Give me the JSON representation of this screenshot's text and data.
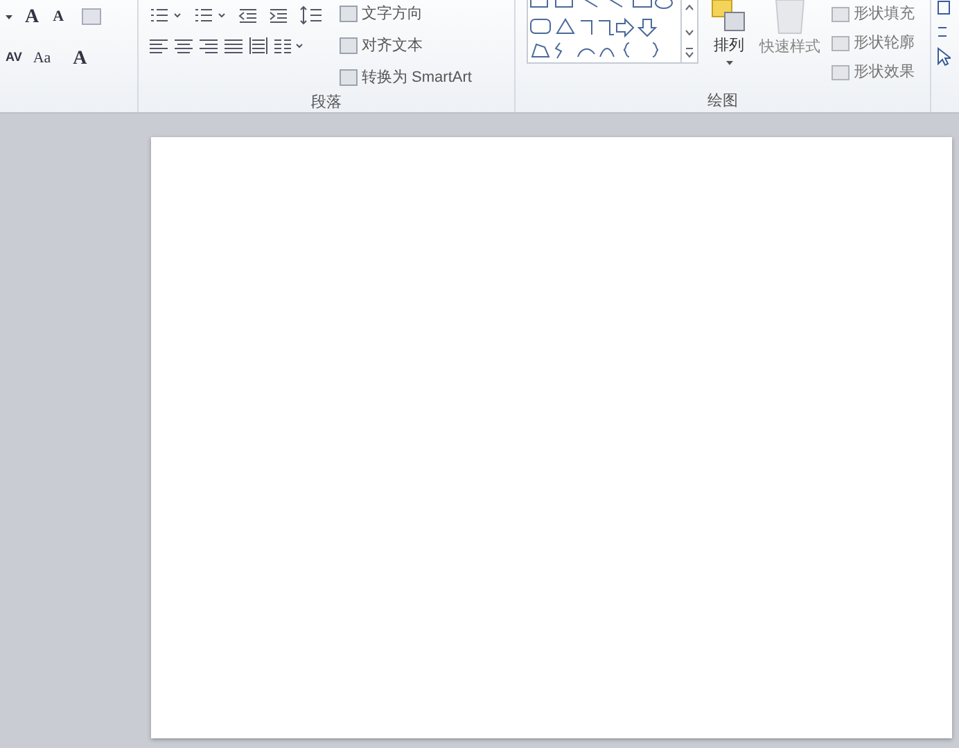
{
  "font_group": {
    "row1": [
      "A",
      "A"
    ],
    "row2": [
      "AV",
      "Aa",
      "A"
    ]
  },
  "paragraph_group": {
    "label": "段落",
    "commands": [
      "文字方向",
      "对齐文本",
      "转换为 SmartArt"
    ]
  },
  "drawing_group": {
    "label": "绘图",
    "arrange": "排列",
    "quick_styles": "快速样式",
    "commands": [
      "形状填充",
      "形状轮廓",
      "形状效果"
    ]
  }
}
